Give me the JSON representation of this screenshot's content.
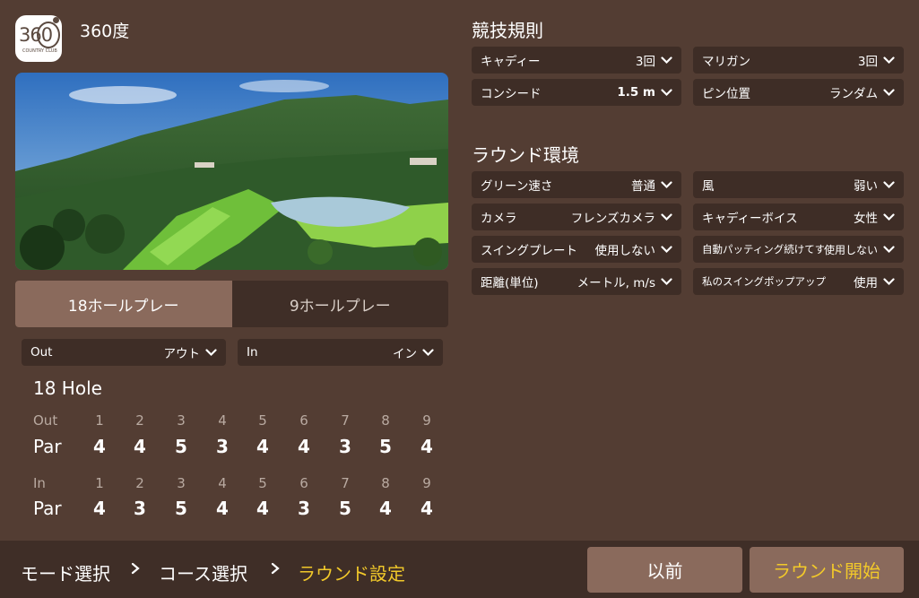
{
  "course": {
    "name": "360度",
    "logo_text": "360",
    "logo_caption": "COUNTRY CLUB"
  },
  "mode_tabs": [
    {
      "label": "18ホールプレー",
      "active": true
    },
    {
      "label": "9ホールプレー",
      "active": false
    }
  ],
  "nine_select": {
    "out": {
      "label": "Out",
      "value": "アウト"
    },
    "in": {
      "label": "In",
      "value": "イン"
    }
  },
  "hole_title": "18 Hole",
  "scorecard": {
    "out": {
      "label": "Out",
      "par_label": "Par",
      "holes": [
        "1",
        "2",
        "3",
        "4",
        "5",
        "6",
        "7",
        "8",
        "9"
      ],
      "pars": [
        "4",
        "4",
        "5",
        "3",
        "4",
        "4",
        "3",
        "5",
        "4"
      ]
    },
    "in": {
      "label": "In",
      "par_label": "Par",
      "holes": [
        "1",
        "2",
        "3",
        "4",
        "5",
        "6",
        "7",
        "8",
        "9"
      ],
      "pars": [
        "4",
        "3",
        "5",
        "4",
        "4",
        "3",
        "5",
        "4",
        "4"
      ]
    }
  },
  "rules": {
    "title": "競技規則",
    "items": [
      {
        "label": "キャディー",
        "value": "3回"
      },
      {
        "label": "マリガン",
        "value": "3回"
      },
      {
        "label": "コンシード",
        "value": "1.5 m"
      },
      {
        "label": "ピン位置",
        "value": "ランダム"
      }
    ]
  },
  "environment": {
    "title": "ラウンド環境",
    "items": [
      {
        "label": "グリーン速さ",
        "value": "普通"
      },
      {
        "label": "風",
        "value": "弱い"
      },
      {
        "label": "カメラ",
        "value": "フレンズカメラ"
      },
      {
        "label": "キャディーボイス",
        "value": "女性"
      },
      {
        "label": "スイングプレート",
        "value": "使用しない"
      },
      {
        "label": "自動パッティング続けてする",
        "value": "使用しない"
      },
      {
        "label": "距離(単位)",
        "value": "メートル, m/s"
      },
      {
        "label": "私のスイングポップアップ",
        "value": "使用"
      }
    ]
  },
  "breadcrumb": [
    {
      "label": "モード選択"
    },
    {
      "label": "コース選択"
    },
    {
      "label": "ラウンド設定"
    }
  ],
  "buttons": {
    "prev": "以前",
    "start": "ラウンド開始"
  },
  "colors": {
    "background": "#533d33",
    "panel": "#3e2d26",
    "accent": "#f2c92a",
    "active_tab": "#8a6a5c"
  },
  "icons": {
    "dropdown": "chevron-down-icon",
    "breadcrumb_sep": "chevron-right-icon"
  }
}
